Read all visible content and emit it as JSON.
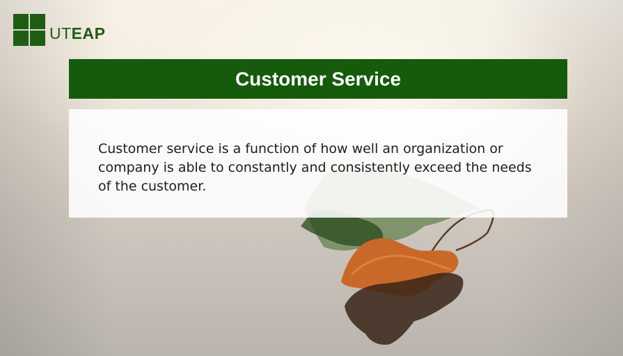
{
  "logo": {
    "text_light": "UT",
    "text_bold": "EAP",
    "icon": "four-squares-logo-icon",
    "color": "#1f5c14"
  },
  "slide": {
    "title": "Customer Service",
    "body": "Customer service is a function of how well an organization or company is able to constantly and consistently exceed the needs of the customer.",
    "title_bar_color": "#165a0c"
  },
  "background": {
    "image": "leaf-floating-on-water-icon"
  }
}
